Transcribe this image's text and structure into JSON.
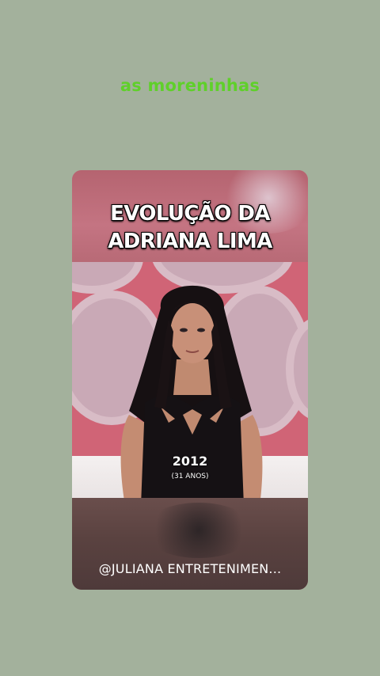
{
  "story": {
    "caption": "as moreninhas"
  },
  "shared_post": {
    "title": "EVOLUÇÃO DA\nADRIANA LIMA",
    "year": "2012",
    "age": "(31 ANOS)",
    "username": "@JULIANA ENTRETENIMEN..."
  },
  "colors": {
    "background": "#a3b19c",
    "caption": "#5fd02a",
    "video_backdrop": "#d06476"
  }
}
